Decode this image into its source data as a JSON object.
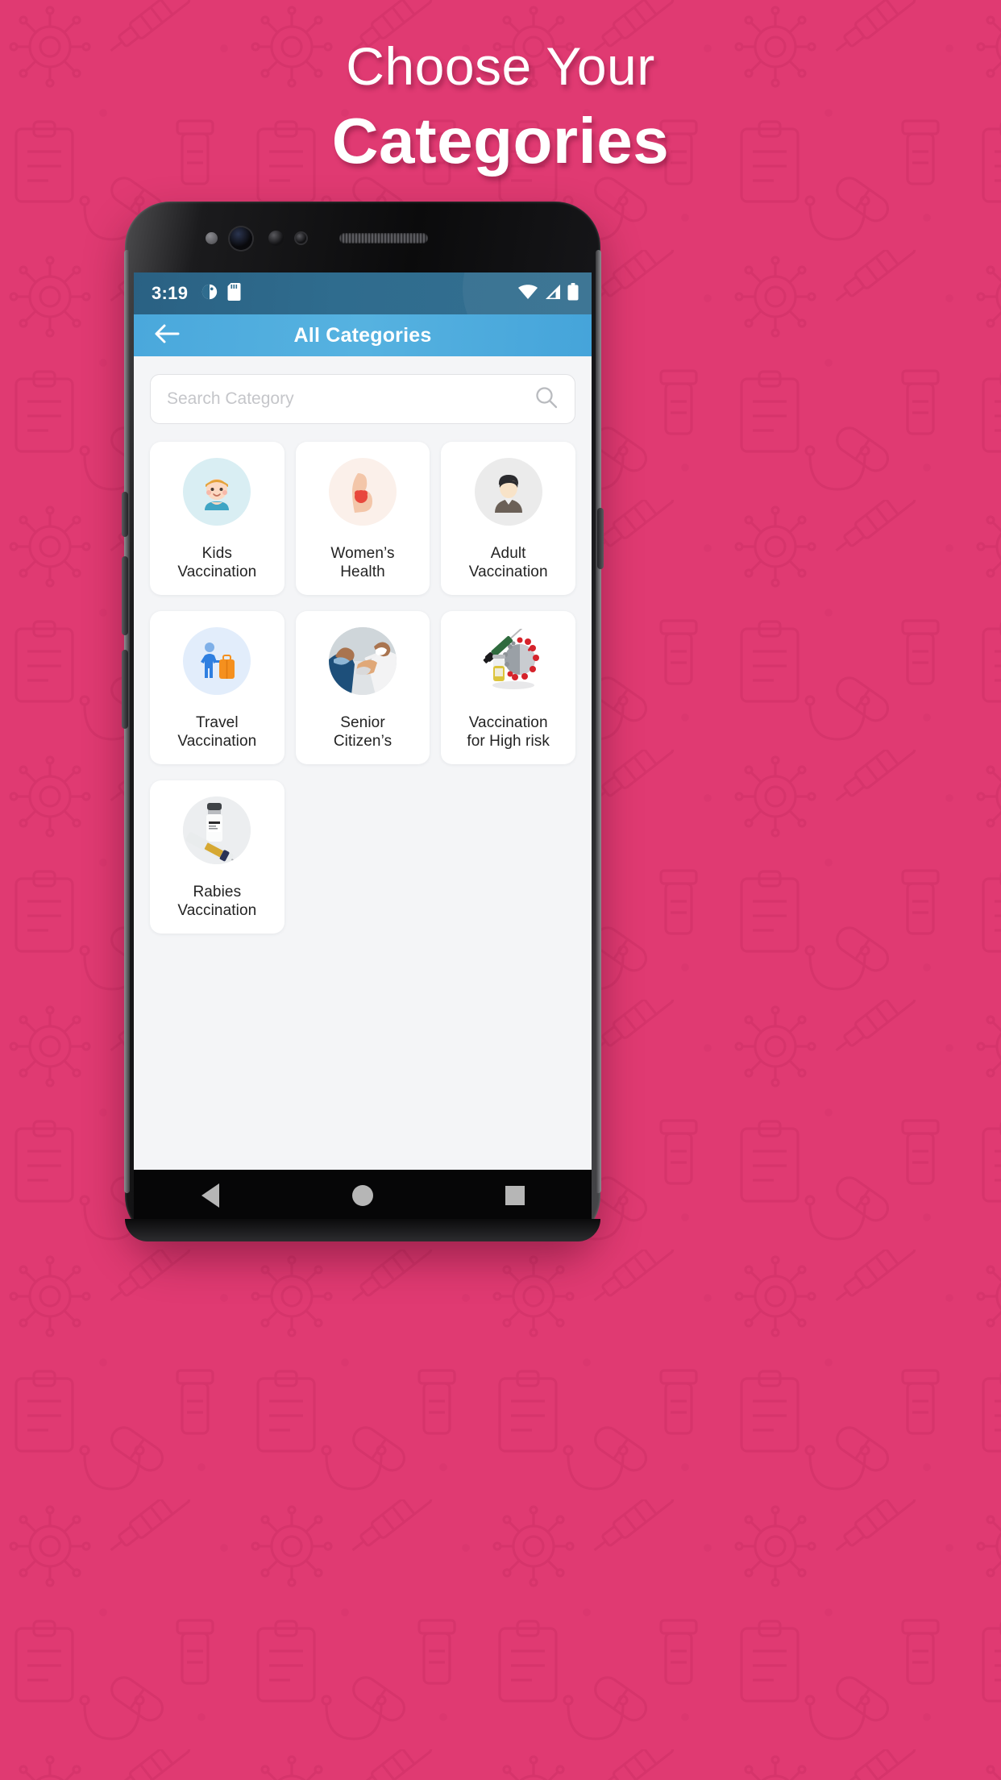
{
  "headline": {
    "line1": "Choose Your",
    "line2": "Categories"
  },
  "colors": {
    "background_pink": "#e03a72",
    "status_bar": "#2f6c8e",
    "app_bar": "#4fadde",
    "screen_background": "#f4f5f7",
    "card_background": "#ffffff",
    "label_text": "#232323",
    "placeholder_text": "#c5c6ca"
  },
  "phone": {
    "status_bar": {
      "time": "3:19",
      "left_icons": [
        "contrast-icon",
        "sd-card-icon"
      ],
      "right_icons": [
        "wifi-icon",
        "signal-icon",
        "battery-icon"
      ]
    },
    "app_bar": {
      "back_icon": "arrow-left-icon",
      "title": "All Categories"
    },
    "search": {
      "placeholder": "Search Category",
      "value": "",
      "icon": "search-icon"
    },
    "categories": [
      {
        "label": "Kids\nVaccination",
        "line1": "Kids",
        "line2": "Vaccination",
        "icon": "child-face-icon",
        "circle_color": "#d9eef3"
      },
      {
        "label": "Women's\nHealth",
        "line1": "Women’s",
        "line2": "Health",
        "icon": "pregnant-woman-icon",
        "circle_color": "#fbf0ea"
      },
      {
        "label": "Adult\nVaccination",
        "line1": "Adult",
        "line2": "Vaccination",
        "icon": "adult-man-icon",
        "circle_color": "#ebebeb"
      },
      {
        "label": "Travel\nVaccination",
        "line1": "Travel",
        "line2": "Vaccination",
        "icon": "traveler-luggage-icon",
        "circle_color": "#e2edfb"
      },
      {
        "label": "Senior\nCitizen's",
        "line1": "Senior",
        "line2": "Citizen’s",
        "icon": "senior-vaccination-photo",
        "circle_color": "#dfe3e6"
      },
      {
        "label": "Vaccination\nfor High risk",
        "line1": "Vaccination",
        "line2": "for High risk",
        "icon": "syringe-virus-photo",
        "circle_color": "#ffffff"
      },
      {
        "label": "Rabies\nVaccination",
        "line1": "Rabies",
        "line2": "Vaccination",
        "icon": "vaccine-vial-syringe-photo",
        "circle_color": "#f0f0f0"
      }
    ],
    "nav_bar": {
      "back_label": "back-triangle-icon",
      "home_label": "home-circle-icon",
      "recents_label": "recents-square-icon"
    }
  }
}
